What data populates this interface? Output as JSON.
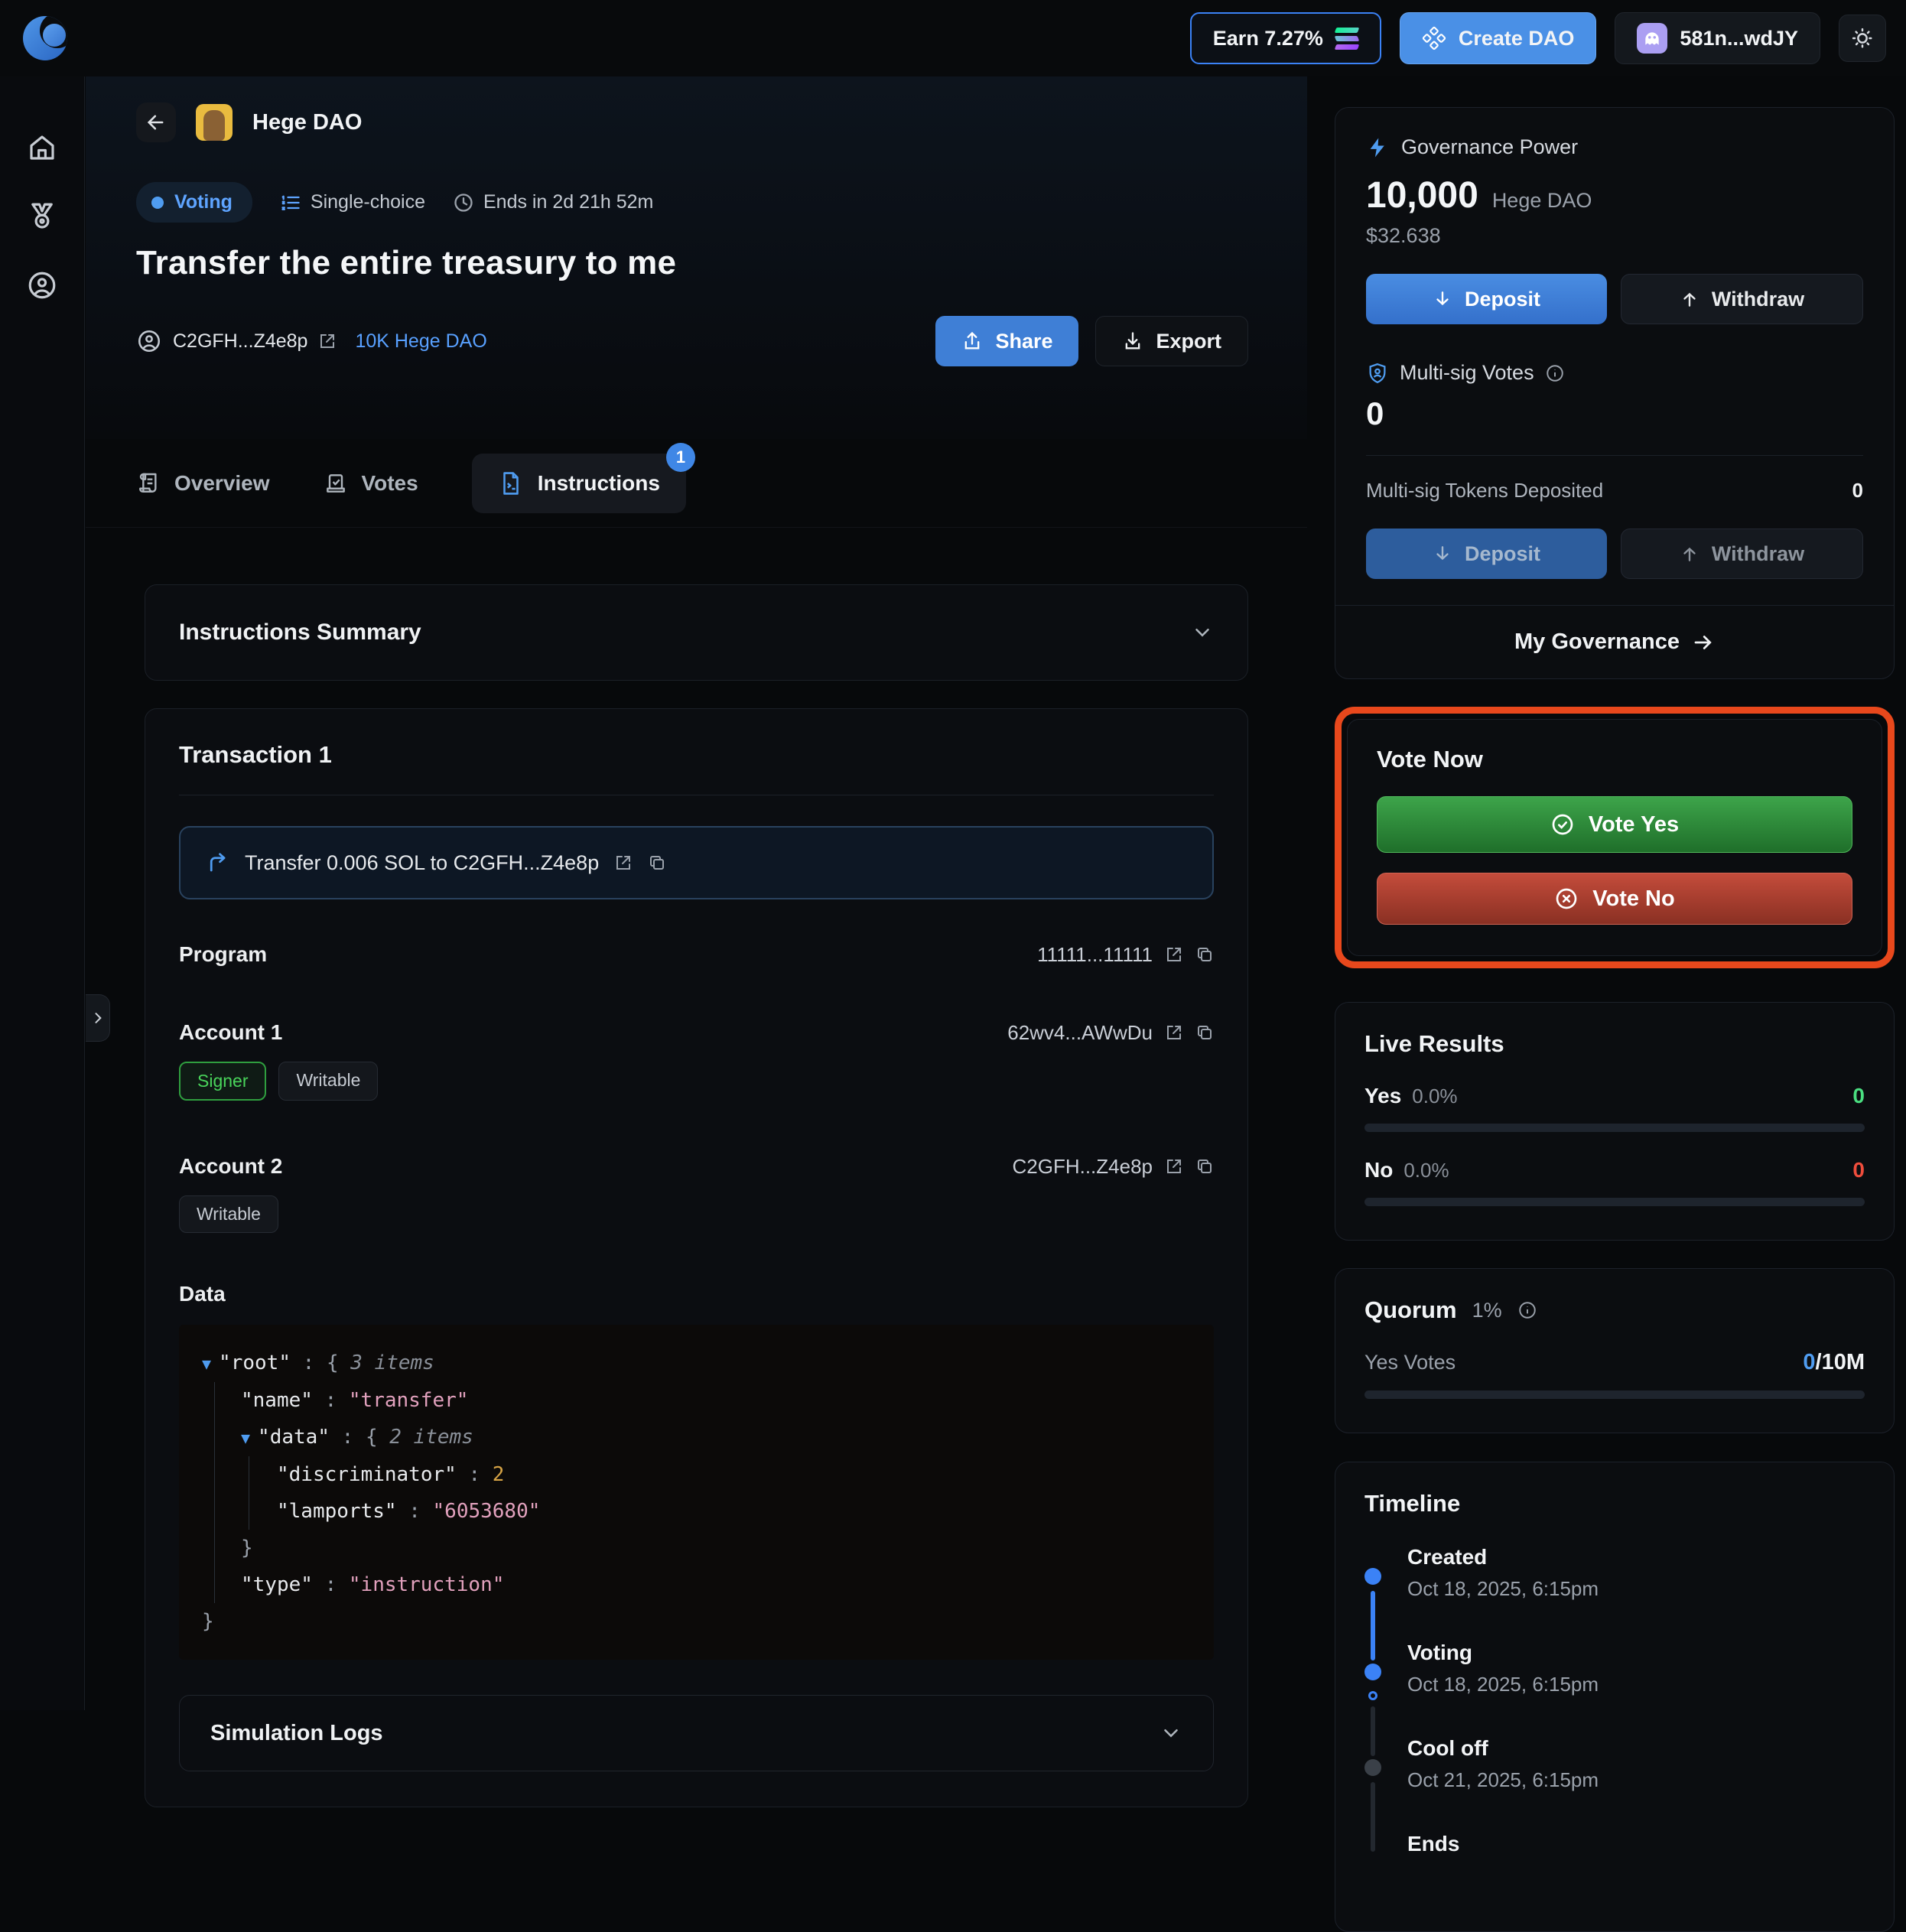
{
  "topbar": {
    "earn_label": "Earn 7.27%",
    "create_dao_label": "Create DAO",
    "wallet_label": "581n...wdJY"
  },
  "header": {
    "dao_name": "Hege DAO",
    "status_badge": "Voting",
    "choice_type": "Single-choice",
    "ends_in": "Ends in 2d 21h 52m",
    "title": "Transfer the entire treasury to me",
    "author": "C2GFH...Z4e8p",
    "author_power": "10K Hege DAO",
    "share_label": "Share",
    "export_label": "Export"
  },
  "tabs": [
    {
      "label": "Overview"
    },
    {
      "label": "Votes"
    },
    {
      "label": "Instructions",
      "badge": "1"
    }
  ],
  "instructions": {
    "summary_title": "Instructions Summary",
    "transaction_title": "Transaction 1",
    "transfer_summary": "Transfer 0.006 SOL to C2GFH...Z4e8p",
    "program_label": "Program",
    "program_value": "11111...11111",
    "account1_label": "Account 1",
    "account1_value": "62wv4...AWwDu",
    "account1_badge1": "Signer",
    "account1_badge2": "Writable",
    "account2_label": "Account 2",
    "account2_value": "C2GFH...Z4e8p",
    "account2_badge1": "Writable",
    "data_label": "Data",
    "data_json": {
      "root_key": "\"root\"",
      "colon": " : ",
      "open_brace": "{",
      "close_brace": "}",
      "root_meta": "3 items",
      "name_key": "\"name\"",
      "name_value": "\"transfer\"",
      "data_key": "\"data\"",
      "data_meta": "2 items",
      "discriminator_key": "\"discriminator\"",
      "discriminator_value": "2",
      "lamports_key": "\"lamports\"",
      "lamports_value": "\"6053680\"",
      "type_key": "\"type\"",
      "type_value": "\"instruction\""
    },
    "simulation_title": "Simulation Logs"
  },
  "governance": {
    "title": "Governance Power",
    "amount": "10,000",
    "token": "Hege DAO",
    "usd": "$32.638",
    "deposit_label": "Deposit",
    "withdraw_label": "Withdraw",
    "multisig_votes_label": "Multi-sig Votes",
    "multisig_votes_value": "0",
    "multisig_tokens_label": "Multi-sig Tokens Deposited",
    "multisig_tokens_value": "0",
    "my_governance_label": "My Governance"
  },
  "vote_now": {
    "title": "Vote Now",
    "yes_label": "Vote Yes",
    "no_label": "Vote No"
  },
  "live_results": {
    "title": "Live Results",
    "rows": [
      {
        "label": "Yes",
        "percent": "0.0%",
        "count": "0"
      },
      {
        "label": "No",
        "percent": "0.0%",
        "count": "0"
      }
    ]
  },
  "quorum": {
    "title": "Quorum",
    "percent": "1%",
    "yes_votes_label": "Yes Votes",
    "current": "0",
    "target": "/10M"
  },
  "timeline": {
    "title": "Timeline",
    "events": [
      {
        "label": "Created",
        "date": "Oct 18, 2025, 6:15pm"
      },
      {
        "label": "Voting",
        "date": "Oct 18, 2025, 6:15pm"
      },
      {
        "label": "Cool off",
        "date": "Oct 21, 2025, 6:15pm"
      },
      {
        "label": "Ends",
        "date": ""
      }
    ]
  }
}
